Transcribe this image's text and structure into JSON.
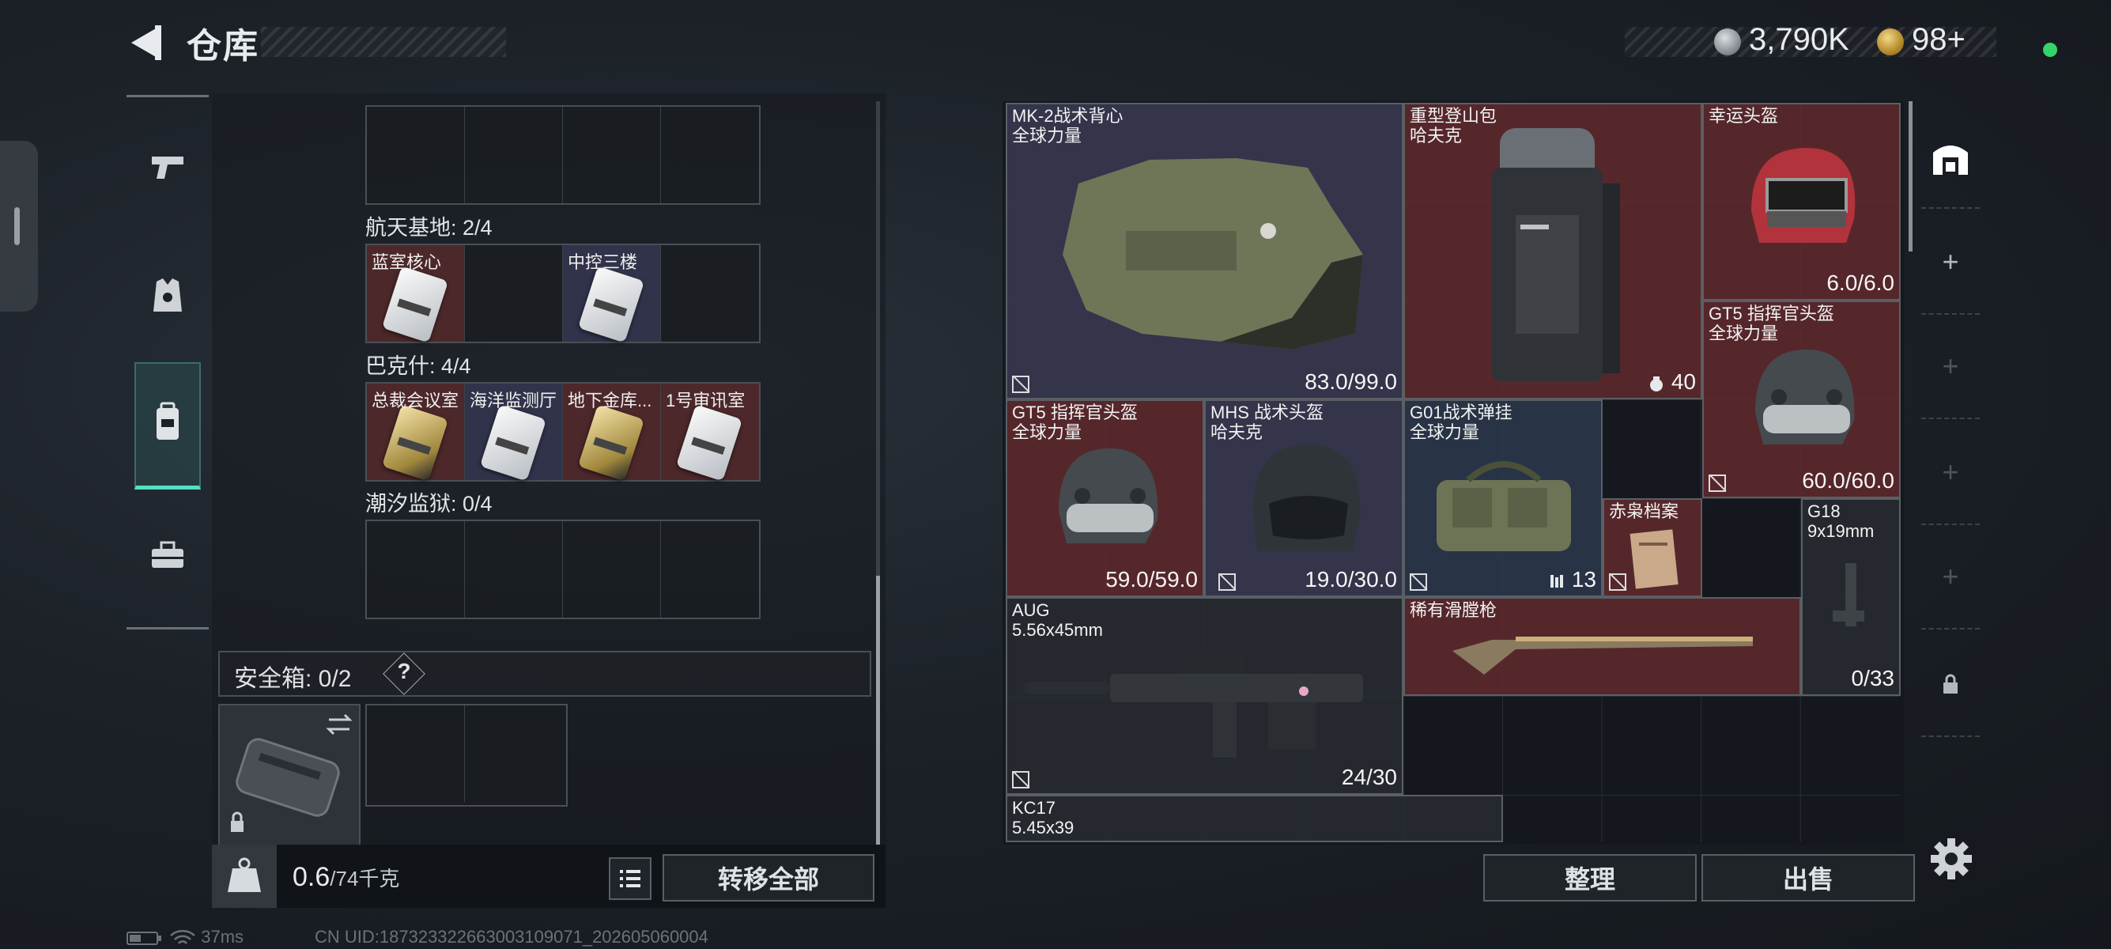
{
  "header": {
    "title": "仓库",
    "money": "3,790K",
    "tokens": "98+"
  },
  "left": {
    "top_group": {
      "slots": [
        "",
        "",
        "",
        ""
      ]
    },
    "groups": [
      {
        "label": "航天基地: 2/4",
        "slots": [
          {
            "name": "蓝室核心",
            "tone": "red",
            "card": "silver"
          },
          {
            "name": "",
            "tone": "",
            "card": ""
          },
          {
            "name": "中控三楼",
            "tone": "violet",
            "card": "silver"
          },
          {
            "name": "",
            "tone": "",
            "card": ""
          }
        ]
      },
      {
        "label": "巴克什: 4/4",
        "slots": [
          {
            "name": "总裁会议室",
            "tone": "red",
            "card": "gold"
          },
          {
            "name": "海洋监测厅",
            "tone": "violet",
            "card": "silver"
          },
          {
            "name": "地下金库...",
            "tone": "red",
            "card": "gold"
          },
          {
            "name": "1号审讯室",
            "tone": "red",
            "card": "silver"
          }
        ]
      },
      {
        "label": "潮汐监狱: 0/4",
        "slots": [
          {
            "name": "",
            "tone": "",
            "card": ""
          },
          {
            "name": "",
            "tone": "",
            "card": ""
          },
          {
            "name": "",
            "tone": "",
            "card": ""
          },
          {
            "name": "",
            "tone": "",
            "card": ""
          }
        ]
      }
    ],
    "safebox": {
      "label": "安全箱: 0/2",
      "help": "?"
    },
    "weight": {
      "current": "0.6",
      "max": "/74千克"
    },
    "transfer_all": "转移全部"
  },
  "status": {
    "latency": "37ms",
    "uid": "CN UID:18732332266300310907​1_202605060004"
  },
  "stash": {
    "items": [
      {
        "id": "vest",
        "name": "MK-2战术背心\n全球力量",
        "value": "83.0/99.0",
        "tone": "purple",
        "mark": true
      },
      {
        "id": "backpack",
        "name": "重型登山包\n哈夫克",
        "value": "40",
        "tone": "red",
        "mark": false
      },
      {
        "id": "helmet-lucky",
        "name": "幸运头盔",
        "value": "6.0/6.0",
        "tone": "red",
        "mark": false
      },
      {
        "id": "gt5-a",
        "name": "GT5 指挥官头盔\n全球力量",
        "value": "60.0/60.0",
        "tone": "red",
        "mark": true
      },
      {
        "id": "gt5-b",
        "name": "GT5 指挥官头盔\n全球力量",
        "value": "59.0/59.0",
        "tone": "red",
        "mark": false
      },
      {
        "id": "mhs",
        "name": "MHS 战术头盔\n哈夫克",
        "value": "19.0/30.0",
        "tone": "purple",
        "mark": true
      },
      {
        "id": "g01",
        "name": "G01战术弹挂\n全球力量",
        "value": "13",
        "tone": "blue",
        "mark": true
      },
      {
        "id": "dossier",
        "name": "赤枭档案",
        "value": "",
        "tone": "red",
        "mark": true
      },
      {
        "id": "g18",
        "name": "G18\n9x19mm",
        "value": "0/33",
        "tone": "dark",
        "mark": false
      },
      {
        "id": "aug",
        "name": "AUG\n5.56x45mm",
        "value": "24/30",
        "tone": "dark",
        "mark": true
      },
      {
        "id": "musket",
        "name": "稀有滑膛枪",
        "value": "",
        "tone": "red",
        "mark": false
      },
      {
        "id": "kc17",
        "name": "KC17\n5.45x39",
        "value": "",
        "tone": "dark",
        "mark": false
      }
    ],
    "sort": "整理",
    "sell": "出售"
  },
  "rail": {
    "add": "+"
  }
}
